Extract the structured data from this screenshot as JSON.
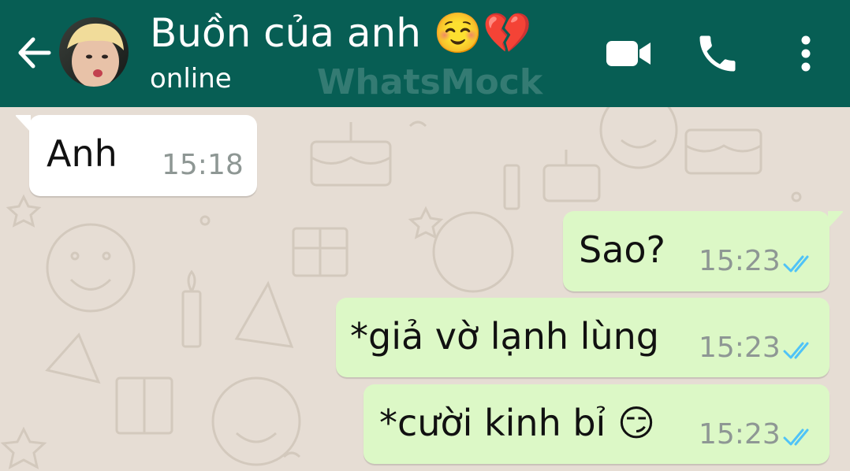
{
  "header": {
    "title": "Buồn của anh ☺️💔",
    "status": "online",
    "watermark": "WhatsMock",
    "back_icon": "arrow-left-icon",
    "video_icon": "video-camera-icon",
    "call_icon": "phone-icon",
    "menu_icon": "more-vertical-icon"
  },
  "colors": {
    "header_bg": "#075e54",
    "chat_bg": "#e6ddd4",
    "incoming_bubble": "#ffffff",
    "outgoing_bubble": "#dcf8c6",
    "read_tick": "#4fc3f7",
    "time_text": "#8e9794"
  },
  "messages": [
    {
      "direction": "incoming",
      "text": "Anh",
      "time": "15:18"
    },
    {
      "direction": "outgoing",
      "text": "Sao?",
      "time": "15:23",
      "status": "read"
    },
    {
      "direction": "outgoing",
      "text": "*giả vờ lạnh lùng",
      "time": "15:23",
      "status": "read"
    },
    {
      "direction": "outgoing",
      "text": "*cười kinh bỉ 😏",
      "time": "15:23",
      "status": "read"
    }
  ]
}
